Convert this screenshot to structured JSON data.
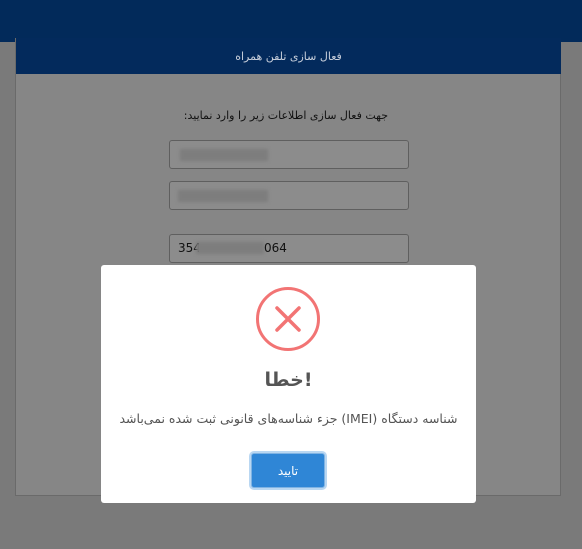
{
  "header": {
    "title": "فعال سازی تلفن همراه"
  },
  "form": {
    "instruction": "جهت فعال سازی اطلاعات زیر را وارد نمایید:",
    "imei_prefix": "354",
    "imei_suffix": "064"
  },
  "dialog": {
    "title": "خطا!",
    "message": "شناسه دستگاه (IMEI) جزء شناسه‌های قانونی ثبت شده نمی‌باشد",
    "confirm_label": "تایید",
    "icon": "error-x-icon",
    "accent_color": "#f27474",
    "button_color": "#2f86d6"
  }
}
